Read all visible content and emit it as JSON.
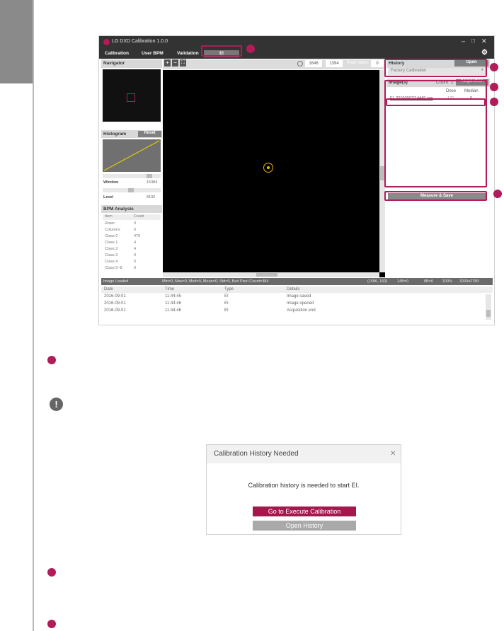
{
  "app": {
    "title": "LG DXD Calibration 1.0.0",
    "menu": [
      "Calibration",
      "User BPM",
      "Validation"
    ],
    "mode_tab_label": "EI",
    "window_controls": [
      "minimize-icon",
      "maximize-icon",
      "close-icon"
    ]
  },
  "toolbar": {
    "zoom_in": "+",
    "zoom_out": "−",
    "fit": "⛶",
    "coord_x": "1646",
    "coord_y": "1394",
    "pixel_value_label": "Pixel Value:",
    "pixel_value": "0"
  },
  "navigator": {
    "title": "Navigator"
  },
  "histogram": {
    "title": "Histogram",
    "reset_label": "Reset",
    "window_label": "Window",
    "window_value": "16384",
    "level_label": "Level",
    "level_value": "8192"
  },
  "bpm": {
    "title": "BPM Analysis",
    "headers": [
      "Item",
      "Count"
    ],
    "rows": [
      [
        "Rows",
        "0"
      ],
      [
        "Columns",
        "0"
      ],
      [
        "Class 0",
        "476"
      ],
      [
        "Class 1",
        "4"
      ],
      [
        "Class 2",
        "4"
      ],
      [
        "Class 3",
        "0"
      ],
      [
        "Class 4",
        "0"
      ],
      [
        "Class 5~8",
        "0"
      ]
    ]
  },
  "history": {
    "title": "History",
    "open_label": "Open",
    "selected": "Factory Calibration"
  },
  "images": {
    "title": "Image(s)",
    "count_label": "Count: 1",
    "acquisition_label": "Acquisition",
    "headers": [
      "Dose",
      "Median"
    ],
    "rows": [
      {
        "name": "EI_20160901114449.raw",
        "dose": "170",
        "median": "0"
      }
    ],
    "measure_save_label": "Measure & Save"
  },
  "status": {
    "left": "Image Loaded",
    "stats": "Min=0, Max=0, Med=0, Mean=0, Std=0, Bad Pixel Count=484",
    "coord": "(1586, 160)",
    "bits": "14B=0",
    "bits2": "8B=0",
    "zoom": "100%",
    "size": "3293x2789"
  },
  "log": {
    "headers": [
      "Date",
      "Time",
      "Type",
      "Details"
    ],
    "rows": [
      [
        "2016-09-01",
        "11:44:45",
        "EI",
        "Image saved"
      ],
      [
        "2016-09-01",
        "11:44:46",
        "EI",
        "Image opened"
      ],
      [
        "2016-09-01",
        "11:44:46",
        "EI",
        "Acquisition end"
      ]
    ]
  },
  "dialog": {
    "title": "Calibration History Needed",
    "message": "Calibration history is needed to start EI.",
    "primary_label": "Go to Execute Calibration",
    "secondary_label": "Open History",
    "close_glyph": "✕"
  },
  "notice_glyph": "!",
  "colors": {
    "accent": "#b31b5a",
    "dark": "#333333",
    "viewer": "#000000",
    "cursor": "#f0b400"
  }
}
